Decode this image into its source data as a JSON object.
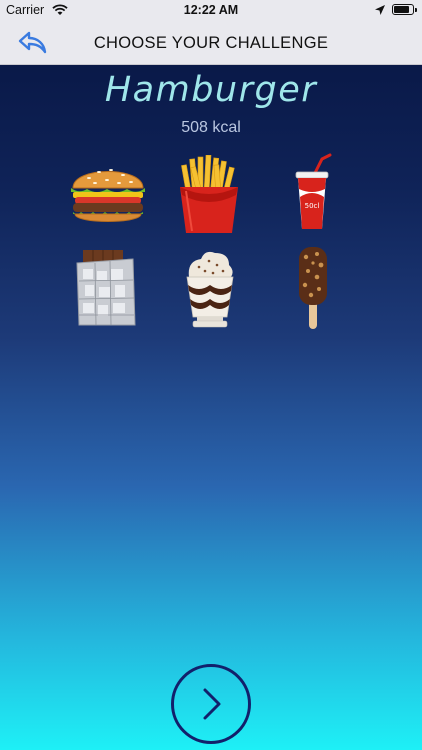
{
  "status": {
    "carrier": "Carrier",
    "time": "12:22 AM",
    "battery_level": 0.9
  },
  "header": {
    "title": "CHOOSE YOUR CHALLENGE",
    "back_icon": "back-arrow-icon"
  },
  "selected": {
    "name": "Hamburger",
    "calories": "508 kcal"
  },
  "foods": [
    {
      "name": "hamburger",
      "label": "",
      "selected": true
    },
    {
      "name": "french-fries",
      "label": ""
    },
    {
      "name": "soda-cup",
      "label": "50cl"
    },
    {
      "name": "chocolate-bar",
      "label": ""
    },
    {
      "name": "sundae",
      "label": ""
    },
    {
      "name": "ice-cream-bar",
      "label": ""
    }
  ],
  "next_icon": "chevron-right-icon",
  "colors": {
    "accent_title": "#9fe6ea",
    "next_ring": "#12206b",
    "back_icon": "#3a7be0"
  }
}
